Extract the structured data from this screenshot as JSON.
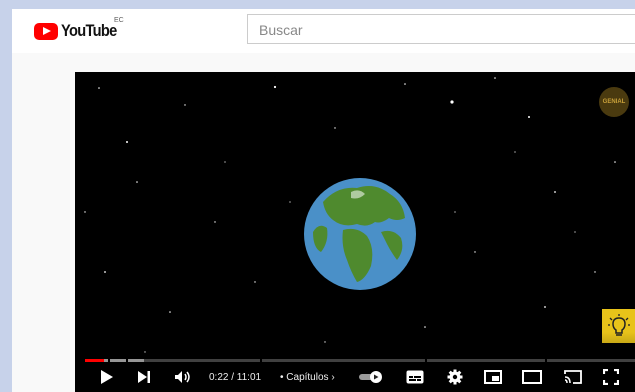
{
  "masthead": {
    "logo_text": "YouTube",
    "region_code": "EC",
    "search_placeholder": "Buscar"
  },
  "player": {
    "channel_badge": "GENIAL",
    "current_time": "0:22",
    "duration": "11:01",
    "time_display": "0:22 / 11:01",
    "chapters_label": "• Capítulos",
    "progress_fraction": 0.033,
    "buffered_fraction": 0.105,
    "icons": [
      "play-icon",
      "next-icon",
      "volume-icon",
      "autoplay-toggle-icon",
      "subtitles-icon",
      "settings-icon",
      "miniplayer-icon",
      "theater-mode-icon",
      "cast-icon",
      "fullscreen-icon"
    ]
  },
  "colors": {
    "brand_red": "#ff0000",
    "page_bg": "#f9f9f9",
    "outer_bg": "#c7d2ea",
    "ocean": "#4a90c8",
    "land": "#4f8a2e",
    "bulb_bg": "#e8c31a"
  }
}
